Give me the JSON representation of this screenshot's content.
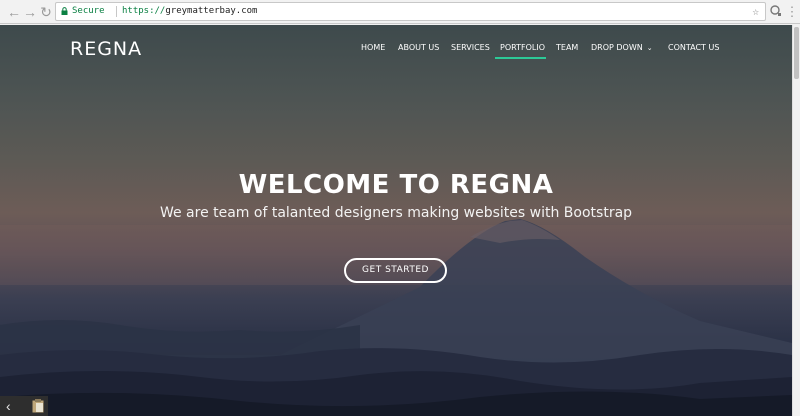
{
  "browser": {
    "secure_label": "Secure",
    "url_protocol": "https://",
    "url_host": "greymatterbay.com"
  },
  "site": {
    "logo": "REGNA",
    "menu": [
      {
        "label": "HOME"
      },
      {
        "label": "ABOUT US"
      },
      {
        "label": "SERVICES"
      },
      {
        "label": "PORTFOLIO",
        "active": true
      },
      {
        "label": "TEAM"
      },
      {
        "label": "DROP DOWN",
        "dropdown": true
      },
      {
        "label": "CONTACT US"
      }
    ],
    "accent_color": "#2dc997"
  },
  "hero": {
    "title": "WELCOME TO REGNA",
    "subtitle": "We are team of talanted designers making websites with Bootstrap",
    "cta_label": "GET STARTED"
  }
}
